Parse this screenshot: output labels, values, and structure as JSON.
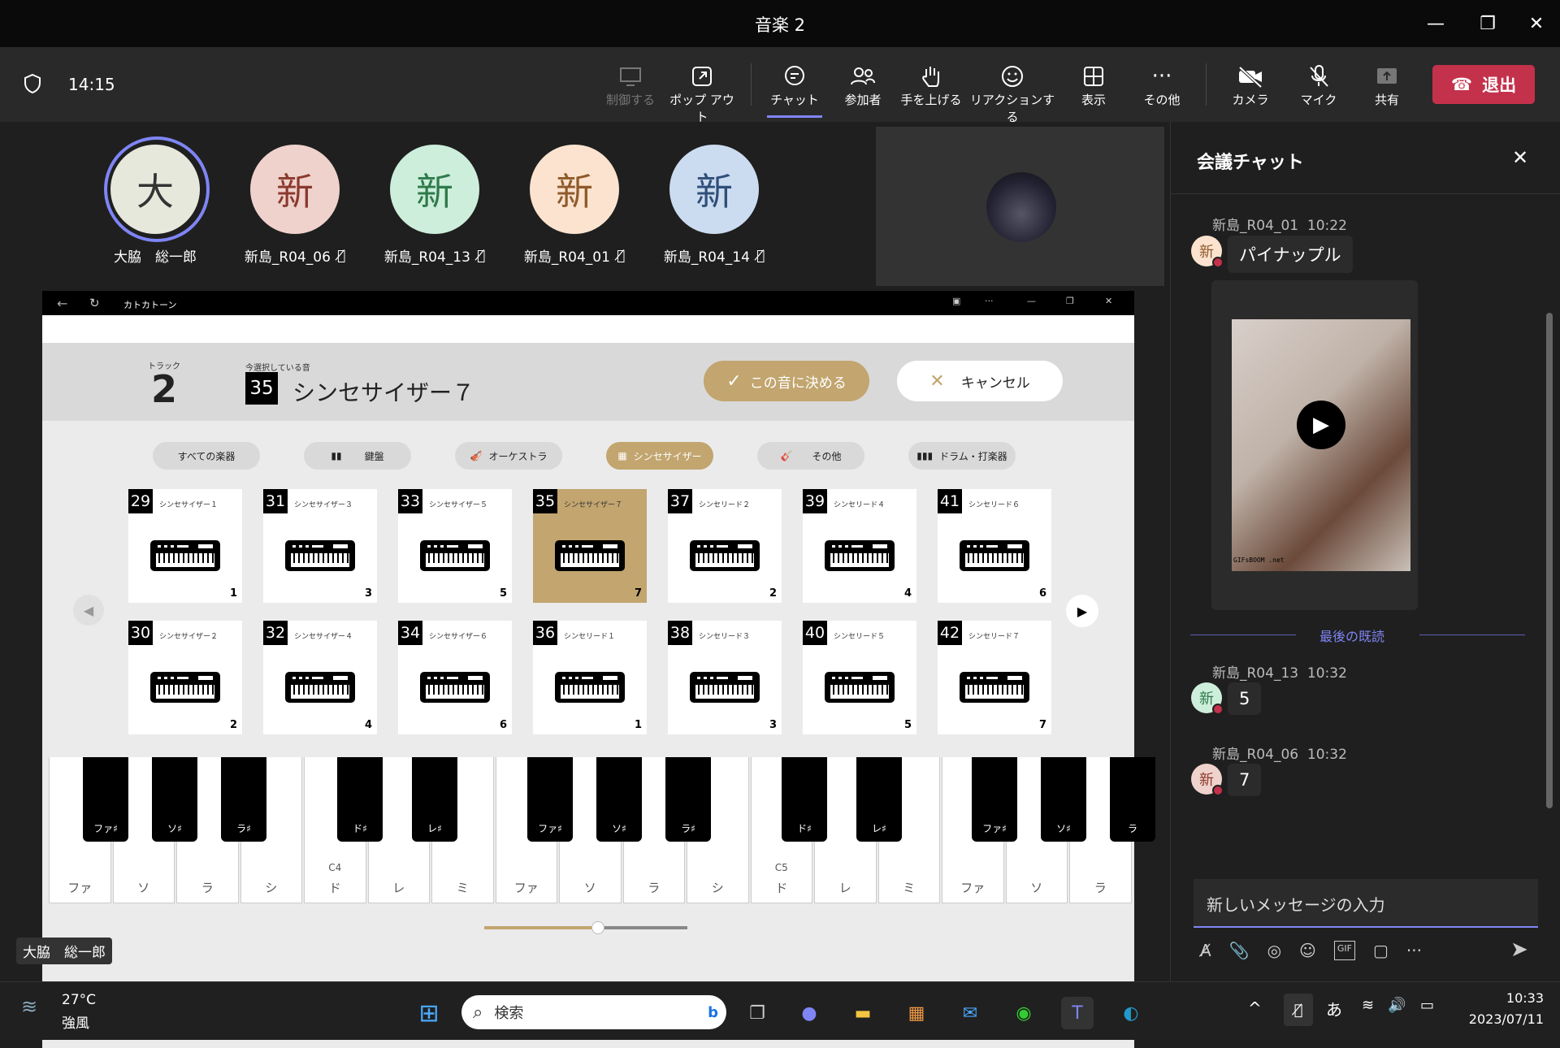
{
  "window": {
    "title": "音楽 2"
  },
  "toolbar": {
    "time": "14:15",
    "buttons": [
      {
        "label": "制御する",
        "icon": "control-icon"
      },
      {
        "label": "ポップ アウト",
        "icon": "popout-icon"
      },
      {
        "label": "チャット",
        "icon": "chat-icon"
      },
      {
        "label": "参加者",
        "icon": "people-icon"
      },
      {
        "label": "手を上げる",
        "icon": "raise-hand-icon"
      },
      {
        "label": "リアクションする",
        "icon": "reaction-icon"
      },
      {
        "label": "表示",
        "icon": "view-icon"
      },
      {
        "label": "その他",
        "icon": "more-icon"
      },
      {
        "label": "カメラ",
        "icon": "camera-off-icon"
      },
      {
        "label": "マイク",
        "icon": "mic-off-icon"
      },
      {
        "label": "共有",
        "icon": "share-icon"
      }
    ],
    "leave": "退出"
  },
  "participants": [
    {
      "initial": "大",
      "name": "大脇　総一郎",
      "color": "#e6e8dc",
      "fg": "#333"
    },
    {
      "initial": "新",
      "name": "新島_R04_06",
      "color": "#f0d2cc",
      "fg": "#8a3a2f"
    },
    {
      "initial": "新",
      "name": "新島_R04_13",
      "color": "#cdeedb",
      "fg": "#2f7a4b"
    },
    {
      "initial": "新",
      "name": "新島_R04_01",
      "color": "#fbe3cf",
      "fg": "#8f5a2b"
    },
    {
      "initial": "新",
      "name": "新島_R04_14",
      "color": "#ccdcf0",
      "fg": "#2f4f7a"
    }
  ],
  "presenter_label": "大脇　総一郎",
  "app": {
    "title": "カトカトーン",
    "track_label": "トラック",
    "track_num": "2",
    "current_label": "今選択している音",
    "current_num": "35",
    "current_name": "シンセサイザー７",
    "confirm": "この音に決める",
    "cancel": "キャンセル",
    "categories": [
      "すべての楽器",
      "鍵盤",
      "オーケストラ",
      "シンセサイザー",
      "その他",
      "ドラム・打楽器"
    ],
    "cards_top": [
      {
        "n": "29",
        "name": "シンセサイザー１",
        "c": "1"
      },
      {
        "n": "31",
        "name": "シンセサイザー３",
        "c": "3"
      },
      {
        "n": "33",
        "name": "シンセサイザー５",
        "c": "5"
      },
      {
        "n": "35",
        "name": "シンセサイザー７",
        "c": "7"
      },
      {
        "n": "37",
        "name": "シンセリード２",
        "c": "2"
      },
      {
        "n": "39",
        "name": "シンセリード４",
        "c": "4"
      },
      {
        "n": "41",
        "name": "シンセリード６",
        "c": "6"
      }
    ],
    "cards_bottom": [
      {
        "n": "30",
        "name": "シンセサイザー２",
        "c": "2"
      },
      {
        "n": "32",
        "name": "シンセサイザー４",
        "c": "4"
      },
      {
        "n": "34",
        "name": "シンセサイザー６",
        "c": "6"
      },
      {
        "n": "36",
        "name": "シンセリード１",
        "c": "1"
      },
      {
        "n": "38",
        "name": "シンセリード３",
        "c": "3"
      },
      {
        "n": "40",
        "name": "シンセリード５",
        "c": "5"
      },
      {
        "n": "42",
        "name": "シンセリード７",
        "c": "7"
      }
    ],
    "white_keys": [
      "ファ",
      "ソ",
      "ラ",
      "シ",
      "ド",
      "レ",
      "ミ",
      "ファ",
      "ソ",
      "ラ",
      "シ",
      "ド",
      "レ",
      "ミ",
      "ファ",
      "ソ",
      "ラ"
    ],
    "c4": "C4",
    "c5": "C5",
    "black_keys": [
      "ファ♯",
      "ソ♯",
      "ラ♯",
      "ド♯",
      "レ♯",
      "ファ♯",
      "ソ♯",
      "ラ♯",
      "ド♯",
      "レ♯",
      "ファ♯",
      "ソ♯",
      "ラ"
    ]
  },
  "chat": {
    "title": "会議チャット",
    "messages": [
      {
        "sender": "新島_R04_01",
        "time": "10:22",
        "text": "パイナップル",
        "av": "#fbe3cf"
      },
      {
        "sender": "新島_R04_13",
        "time": "10:32",
        "text": "5",
        "av": "#cdeedb"
      },
      {
        "sender": "新島_R04_06",
        "time": "10:32",
        "text": "7",
        "av": "#f0d2cc"
      }
    ],
    "gif_caption": "GIFsBOOM .net",
    "last_read": "最後の既読",
    "input_placeholder": "新しいメッセージの入力"
  },
  "taskbar": {
    "temp": "27°C",
    "weather": "強風",
    "search": "検索",
    "ime": "あ",
    "time": "10:33",
    "date": "2023/07/11"
  }
}
